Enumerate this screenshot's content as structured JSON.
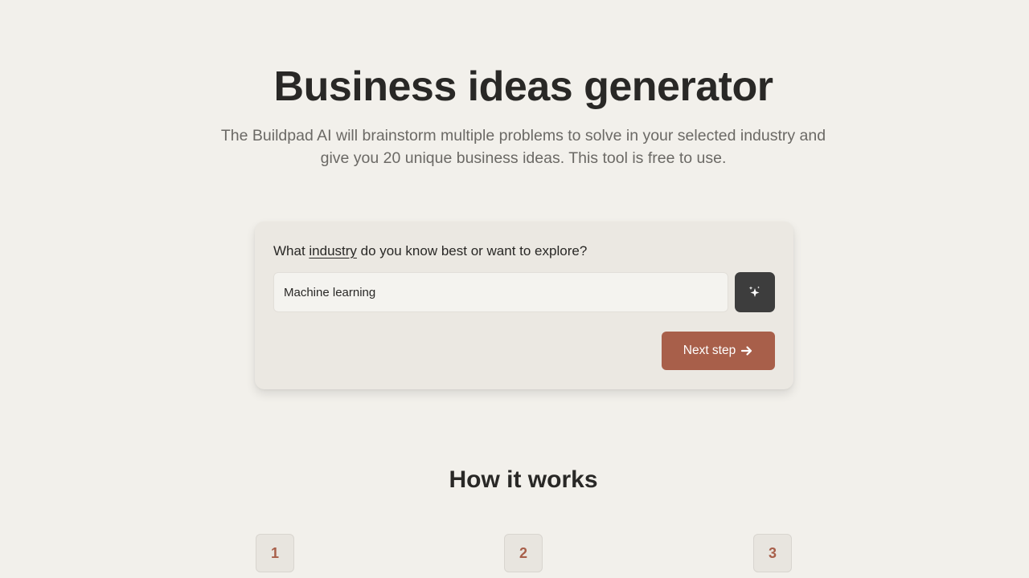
{
  "hero": {
    "title": "Business ideas generator",
    "subtitle": "The Buildpad AI will brainstorm multiple problems to solve in your selected industry and give you 20 unique business ideas. This tool is free to use."
  },
  "form": {
    "question_prefix": "What ",
    "question_keyword": "industry",
    "question_suffix": " do you know best or want to explore?",
    "input_value": "Machine learning",
    "magic_button_icon": "sparkles-icon",
    "next_label": "Next step",
    "next_icon": "arrow-right-icon"
  },
  "how_it_works": {
    "title": "How it works",
    "steps": [
      {
        "number": "1"
      },
      {
        "number": "2"
      },
      {
        "number": "3"
      }
    ]
  },
  "colors": {
    "background": "#f2f0eb",
    "card": "#ebe8e2",
    "accent": "#a85f4a",
    "dark_button": "#3d3d3d",
    "text": "#292826",
    "muted_text": "#6b6965"
  }
}
